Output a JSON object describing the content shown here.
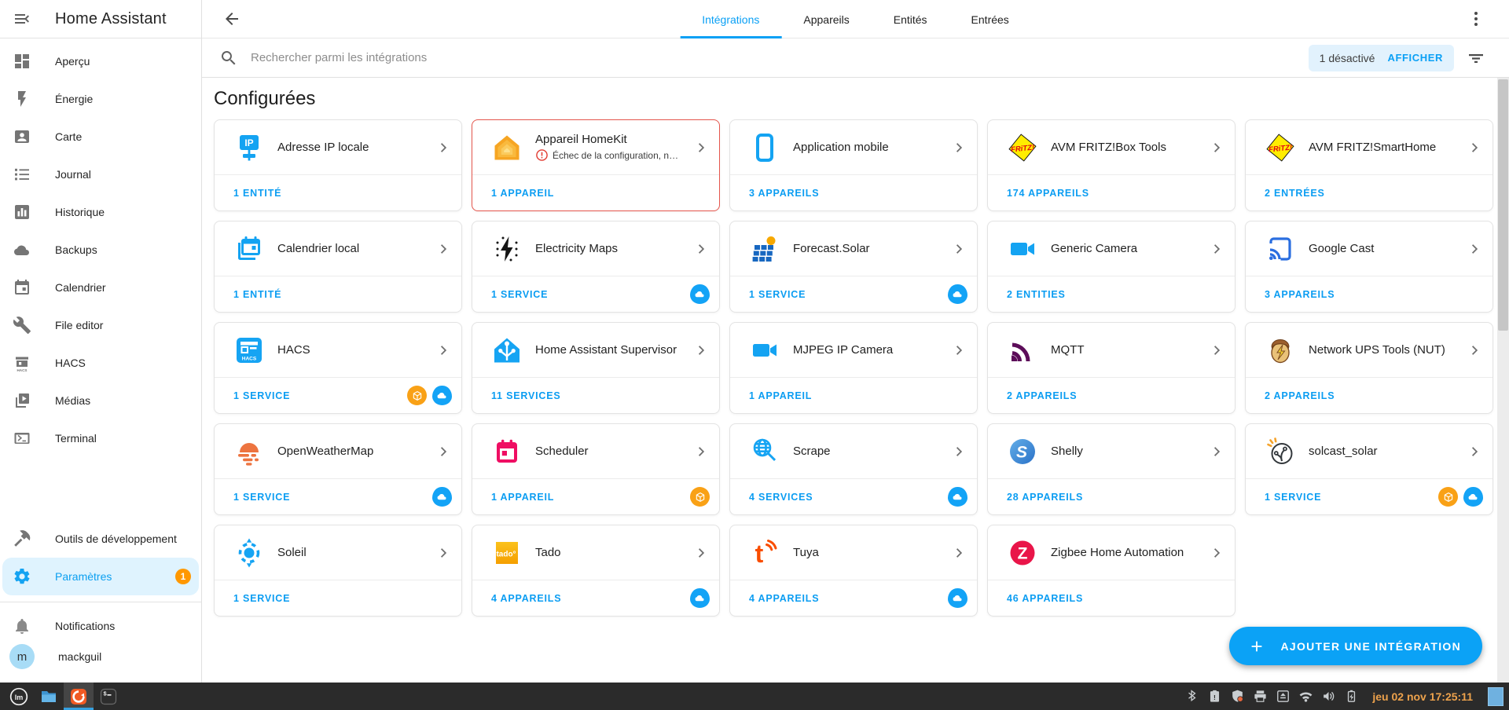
{
  "sidebar": {
    "title": "Home Assistant",
    "menu_icon": "menu-open",
    "items": [
      {
        "label": "Aperçu",
        "icon": "dashboard"
      },
      {
        "label": "Énergie",
        "icon": "lightning-bolt"
      },
      {
        "label": "Carte",
        "icon": "person-card"
      },
      {
        "label": "Journal",
        "icon": "bulleted-list"
      },
      {
        "label": "Historique",
        "icon": "bar-chart"
      },
      {
        "label": "Backups",
        "icon": "cloud"
      },
      {
        "label": "Calendrier",
        "icon": "calendar"
      },
      {
        "label": "File editor",
        "icon": "wrench"
      },
      {
        "label": "HACS",
        "icon": "hacs-store"
      },
      {
        "label": "Médias",
        "icon": "media-play"
      },
      {
        "label": "Terminal",
        "icon": "console"
      }
    ],
    "bottom_items": [
      {
        "label": "Outils de développement",
        "icon": "hammer",
        "active": false,
        "badge": ""
      },
      {
        "label": "Paramètres",
        "icon": "gear",
        "active": true,
        "badge": "1"
      }
    ],
    "notifications": {
      "label": "Notifications",
      "icon": "bell"
    },
    "user": {
      "name": "mackguil",
      "avatar_letter": "m"
    }
  },
  "topbar": {
    "back_icon": "arrow-left",
    "overflow_icon": "kebab-menu",
    "tabs": [
      {
        "label": "Intégrations",
        "active": true
      },
      {
        "label": "Appareils",
        "active": false
      },
      {
        "label": "Entités",
        "active": false
      },
      {
        "label": "Entrées",
        "active": false
      }
    ]
  },
  "search": {
    "icon": "magnifier",
    "placeholder": "Rechercher parmi les intégrations",
    "disabled_chip": {
      "text": "1 désactivé",
      "action": "AFFICHER"
    },
    "filter_icon": "filter-lines"
  },
  "section_title": "Configurées",
  "integrations": [
    {
      "name": "Adresse IP locale",
      "icon": "local-ip",
      "count": "1 ENTITÉ",
      "badges": [],
      "error": ""
    },
    {
      "name": "Appareil HomeKit",
      "icon": "homekit",
      "count": "1 APPAREIL",
      "badges": [],
      "error": "Échec de la configuration, nouvel …"
    },
    {
      "name": "Application mobile",
      "icon": "mobile-app",
      "count": "3 APPAREILS",
      "badges": [],
      "error": ""
    },
    {
      "name": "AVM FRITZ!Box Tools",
      "icon": "fritz",
      "count": "174 APPAREILS",
      "badges": [],
      "error": ""
    },
    {
      "name": "AVM FRITZ!SmartHome",
      "icon": "fritz",
      "count": "2 ENTRÉES",
      "badges": [],
      "error": ""
    },
    {
      "name": "Calendrier local",
      "icon": "local-calendar",
      "count": "1 ENTITÉ",
      "badges": [],
      "error": ""
    },
    {
      "name": "Electricity Maps",
      "icon": "electricity-maps",
      "count": "1 SERVICE",
      "badges": [
        "cloud"
      ],
      "error": ""
    },
    {
      "name": "Forecast.Solar",
      "icon": "forecast-solar",
      "count": "1 SERVICE",
      "badges": [
        "cloud"
      ],
      "error": ""
    },
    {
      "name": "Generic Camera",
      "icon": "video-camera",
      "count": "2 ENTITIES",
      "badges": [],
      "error": ""
    },
    {
      "name": "Google Cast",
      "icon": "cast",
      "count": "3 APPAREILS",
      "badges": [],
      "error": ""
    },
    {
      "name": "HACS",
      "icon": "hacs",
      "count": "1 SERVICE",
      "badges": [
        "custom",
        "cloud"
      ],
      "error": ""
    },
    {
      "name": "Home Assistant Supervisor",
      "icon": "home-assistant",
      "count": "11 SERVICES",
      "badges": [],
      "error": ""
    },
    {
      "name": "MJPEG IP Camera",
      "icon": "video-camera",
      "count": "1 APPAREIL",
      "badges": [],
      "error": ""
    },
    {
      "name": "MQTT",
      "icon": "mqtt",
      "count": "2 APPAREILS",
      "badges": [],
      "error": ""
    },
    {
      "name": "Network UPS Tools (NUT)",
      "icon": "nut",
      "count": "2 APPAREILS",
      "badges": [],
      "error": ""
    },
    {
      "name": "OpenWeatherMap",
      "icon": "openweathermap",
      "count": "1 SERVICE",
      "badges": [
        "cloud"
      ],
      "error": ""
    },
    {
      "name": "Scheduler",
      "icon": "scheduler",
      "count": "1 APPAREIL",
      "badges": [
        "custom"
      ],
      "error": ""
    },
    {
      "name": "Scrape",
      "icon": "scrape",
      "count": "4 SERVICES",
      "badges": [
        "cloud"
      ],
      "error": ""
    },
    {
      "name": "Shelly",
      "icon": "shelly",
      "count": "28 APPAREILS",
      "badges": [],
      "error": ""
    },
    {
      "name": "solcast_solar",
      "icon": "solcast",
      "count": "1 SERVICE",
      "badges": [
        "custom",
        "cloud"
      ],
      "error": ""
    },
    {
      "name": "Soleil",
      "icon": "sun",
      "count": "1 SERVICE",
      "badges": [],
      "error": ""
    },
    {
      "name": "Tado",
      "icon": "tado",
      "count": "4 APPAREILS",
      "badges": [
        "cloud"
      ],
      "error": ""
    },
    {
      "name": "Tuya",
      "icon": "tuya",
      "count": "4 APPAREILS",
      "badges": [
        "cloud"
      ],
      "error": ""
    },
    {
      "name": "Zigbee Home Automation",
      "icon": "zha",
      "count": "46 APPAREILS",
      "badges": [],
      "error": ""
    }
  ],
  "fab": {
    "label": "AJOUTER UNE INTÉGRATION",
    "icon": "plus"
  },
  "taskbar": {
    "apps": [
      {
        "name": "mint-menu",
        "active": false
      },
      {
        "name": "file-manager",
        "active": false
      },
      {
        "name": "browser",
        "active": true
      },
      {
        "name": "terminal-app",
        "active": false
      }
    ],
    "tray": [
      "bluetooth",
      "clipboard",
      "shield",
      "printer",
      "removable-drive",
      "wifi",
      "volume",
      "battery-charging"
    ],
    "clock": "jeu 02 nov 17:25:11"
  },
  "colors": {
    "accent": "#0aa0f5",
    "count_text": "#0b9df2",
    "badge_custom": "#f9a116",
    "badge_cloud": "#13a3f6",
    "error_border": "#e5564d",
    "settings_badge": "#ff9800",
    "taskbar_bg": "#2b2b2b",
    "clock_text": "#eda24c"
  }
}
